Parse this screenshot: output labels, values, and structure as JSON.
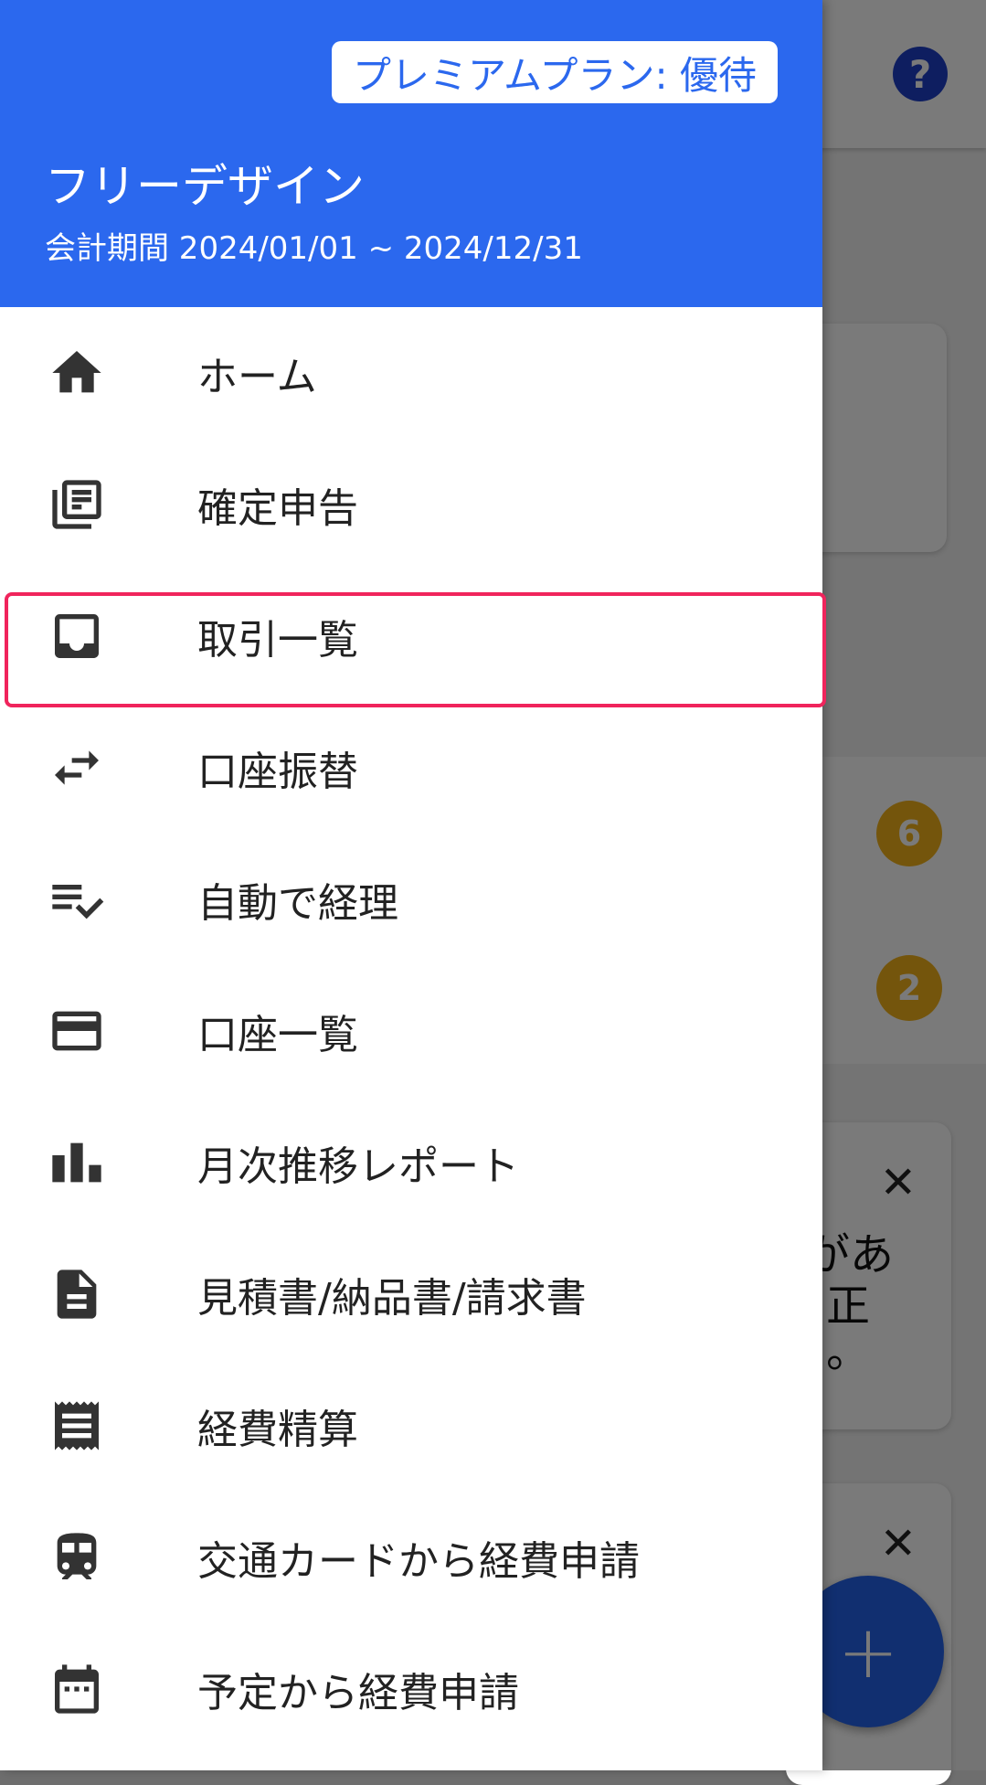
{
  "background": {
    "help_icon": "?",
    "badges": [
      "6",
      "2"
    ],
    "notice_1_lines": [
      "があ",
      "正",
      "。"
    ],
    "close_icon": "✕",
    "fab_icon": "+"
  },
  "drawer": {
    "plan_badge": "プレミアムプラン: 優待",
    "company_name": "フリーデザイン",
    "fiscal_period": "会計期間 2024/01/01 ~ 2024/12/31",
    "highlighted_item": "取引一覧",
    "items": [
      {
        "label": "ホーム",
        "icon": "home-icon"
      },
      {
        "label": "確定申告",
        "icon": "library-books-icon"
      },
      {
        "label": "取引一覧",
        "icon": "inbox-icon"
      },
      {
        "label": "口座振替",
        "icon": "swap-horiz-icon"
      },
      {
        "label": "自動で経理",
        "icon": "playlist-add-check-icon"
      },
      {
        "label": "口座一覧",
        "icon": "credit-card-icon"
      },
      {
        "label": "月次推移レポート",
        "icon": "bar-chart-icon"
      },
      {
        "label": "見積書/納品書/請求書",
        "icon": "description-icon"
      },
      {
        "label": "経費精算",
        "icon": "receipt-icon"
      },
      {
        "label": "交通カードから経費申請",
        "icon": "train-icon"
      },
      {
        "label": "予定から経費申請",
        "icon": "calendar-icon"
      }
    ]
  },
  "colors": {
    "header_blue": "#2b68ee",
    "highlight_border": "#f0245c",
    "badge_yellow": "#f3b21a",
    "fab_blue": "#2563eb",
    "help_blue": "#1e40c8"
  }
}
